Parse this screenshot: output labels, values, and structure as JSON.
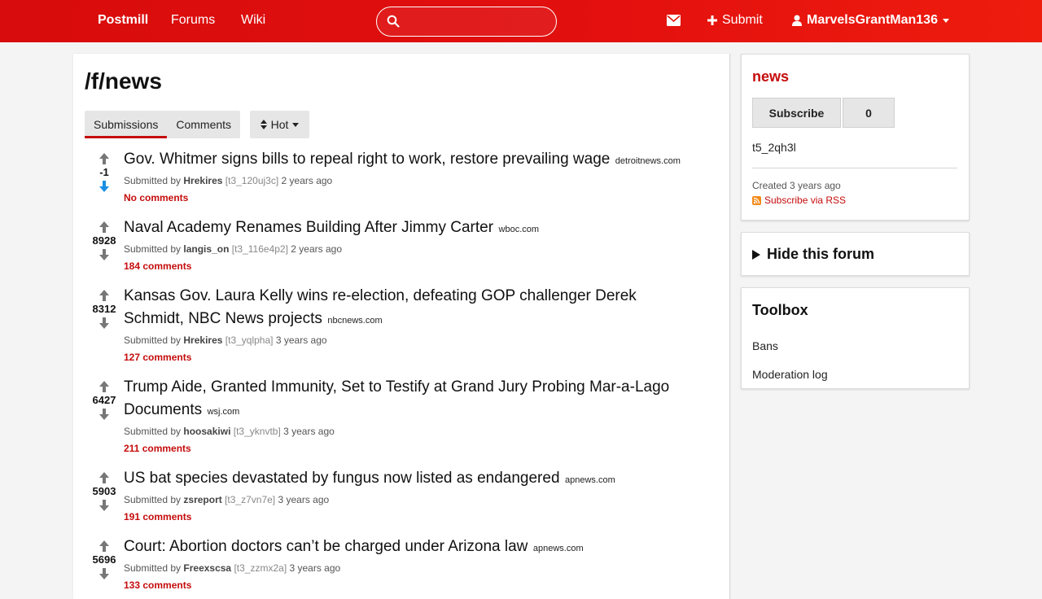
{
  "navbar": {
    "brand": "Postmill",
    "forums": "Forums",
    "wiki": "Wiki",
    "search_placeholder": "",
    "submit": "Submit",
    "user": "MarvelsGrantMan136",
    "color": "#e0120f"
  },
  "main": {
    "title": "/f/news",
    "tabs": [
      {
        "label": "Submissions",
        "active": true
      },
      {
        "label": "Comments",
        "active": false
      }
    ],
    "sort": "Hot"
  },
  "submissions": [
    {
      "score": "-1",
      "title": "Gov. Whitmer signs bills to repeal right to work, restore prevailing wage",
      "domain": "detroitnews.com",
      "submitted_by": "Submitted by",
      "author": "Hrekires",
      "id": "[t3_120uj3c]",
      "age": "2 years ago",
      "comments": "No comments",
      "voted": "down"
    },
    {
      "score": "8928",
      "title": "Naval Academy Renames Building After Jimmy Carter",
      "domain": "wboc.com",
      "submitted_by": "Submitted by",
      "author": "langis_on",
      "id": "[t3_116e4p2]",
      "age": "2 years ago",
      "comments": "184 comments",
      "voted": "none"
    },
    {
      "score": "8312",
      "title": "Kansas Gov. Laura Kelly wins re-election, defeating GOP challenger Derek Schmidt, NBC News projects",
      "domain": "nbcnews.com",
      "submitted_by": "Submitted by",
      "author": "Hrekires",
      "id": "[t3_yqlpha]",
      "age": "3 years ago",
      "comments": "127 comments",
      "voted": "none"
    },
    {
      "score": "6427",
      "title": "Trump Aide, Granted Immunity, Set to Testify at Grand Jury Probing Mar-a-Lago Documents",
      "domain": "wsj.com",
      "submitted_by": "Submitted by",
      "author": "hoosakiwi",
      "id": "[t3_yknvtb]",
      "age": "3 years ago",
      "comments": "211 comments",
      "voted": "none"
    },
    {
      "score": "5903",
      "title": "US bat species devastated by fungus now listed as endangered",
      "domain": "apnews.com",
      "submitted_by": "Submitted by",
      "author": "zsreport",
      "id": "[t3_z7vn7e]",
      "age": "3 years ago",
      "comments": "191 comments",
      "voted": "none"
    },
    {
      "score": "5696",
      "title": "Court: Abortion doctors can’t be charged under Arizona law",
      "domain": "apnews.com",
      "submitted_by": "Submitted by",
      "author": "Freexscsa",
      "id": "[t3_zzmx2a]",
      "age": "3 years ago",
      "comments": "133 comments",
      "voted": "none"
    }
  ],
  "sidebar": {
    "forum_name": "news",
    "subscribe": "Subscribe",
    "subscriber_count": "0",
    "forum_id": "t5_2qh3l",
    "created": "Created 3 years ago",
    "rss": "Subscribe via RSS",
    "hide_forum": "Hide this forum",
    "toolbox_title": "Toolbox",
    "toolbox_links": [
      "Bans",
      "Moderation log"
    ]
  }
}
